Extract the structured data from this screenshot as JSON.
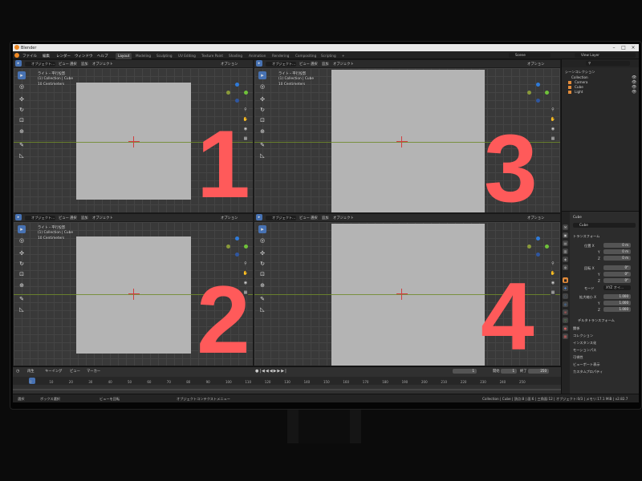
{
  "app": {
    "title": "Blender",
    "scene": "Scene",
    "view_layer": "View Layer"
  },
  "menu": [
    "ファイル",
    "編集",
    "レンダー",
    "ウィンドウ",
    "ヘルプ"
  ],
  "workspaces": [
    "Layout",
    "Modeling",
    "Sculpting",
    "UV Editing",
    "Texture Paint",
    "Shading",
    "Animation",
    "Rendering",
    "Compositing",
    "Scripting",
    "+"
  ],
  "viewport_header": {
    "mode": "オブジェクト...",
    "menus": [
      "ビュー",
      "選択",
      "追加",
      "オブジェクト"
    ],
    "transform": "グロー...",
    "options": "オプション"
  },
  "viewport_overlay": {
    "line1": "ライト・平行投影",
    "line2": "(1) Collection | Cube",
    "line3": "10 Centimeters"
  },
  "viewport_numbers": [
    "1",
    "2",
    "3",
    "4"
  ],
  "outliner": {
    "header": "シーンコレクション",
    "items": [
      "Collection",
      "Camera",
      "Cube",
      "Light"
    ]
  },
  "properties": {
    "object_name": "Cube",
    "data_name": "Cube",
    "section": "トランスフォーム",
    "location_label": "位置 X",
    "rotation_label": "回転 X",
    "scale_label": "拡大縮小 X",
    "mode_label": "モード",
    "mode_value": "XYZ オイ...",
    "axes": [
      "Y",
      "Z"
    ],
    "location_values": [
      "0 m",
      "0 m",
      "0 m"
    ],
    "rotation_values": [
      "0°",
      "0°",
      "0°"
    ],
    "scale_values": [
      "1.000",
      "1.000",
      "1.000"
    ],
    "delta": "デルタトランスフォーム",
    "panels": [
      "関係",
      "コレクション",
      "インスタンス化",
      "モーションパス",
      "可視性",
      "ビューポート表示",
      "カスタムプロパティ"
    ]
  },
  "timeline": {
    "menus": [
      "再生",
      "キーイング",
      "ビュー",
      "マーカー"
    ],
    "current_frame": "1",
    "start_label": "開始",
    "start": "1",
    "end_label": "終了",
    "end": "250",
    "ticks": [
      "0",
      "10",
      "20",
      "30",
      "40",
      "50",
      "60",
      "70",
      "80",
      "90",
      "100",
      "110",
      "120",
      "130",
      "140",
      "150",
      "160",
      "170",
      "180",
      "190",
      "200",
      "210",
      "220",
      "230",
      "240",
      "250"
    ]
  },
  "statusbar": {
    "left": [
      "選択",
      "ボックス選択",
      "ビューを回転",
      "オブジェクトコンテクストメニュー"
    ],
    "right": "Collection | Cube | 頂点:8 | 面:6 | 三角面:12 | オブジェクト:0/3 | メモリ:17.1 MiB | v2.82.7"
  },
  "colors": {
    "accent": "#4772b3",
    "number": "#ff5a5a",
    "camera": "#b4b4b4"
  }
}
